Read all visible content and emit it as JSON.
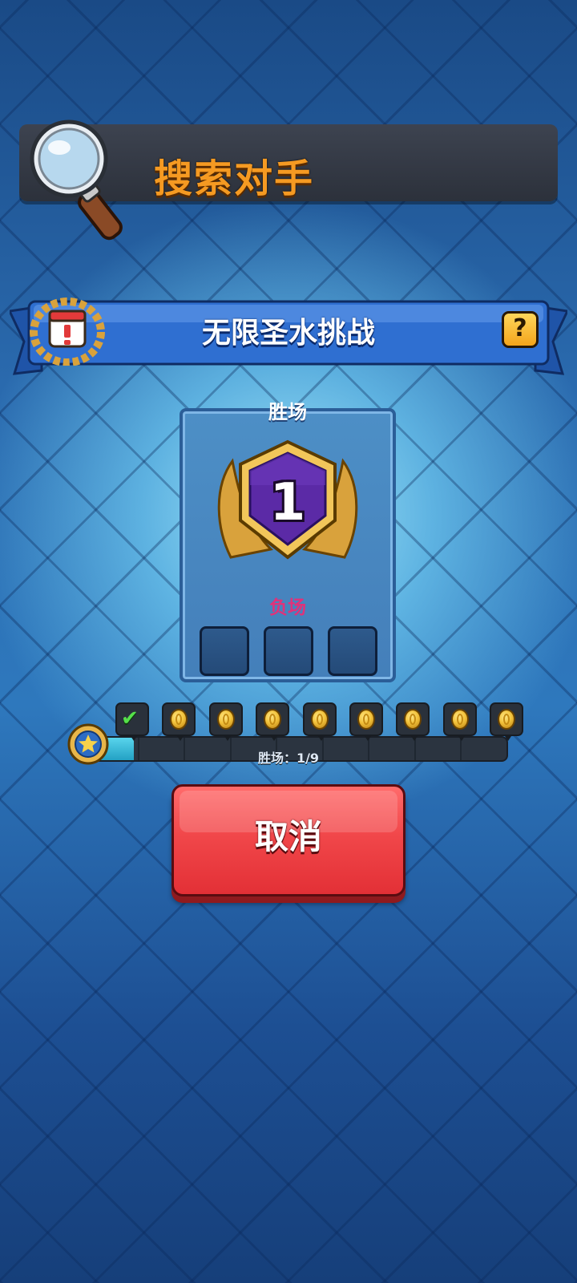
{
  "header": {
    "title": "搜索对手",
    "icon": "magnifier-icon"
  },
  "challenge": {
    "name": "无限圣水挑战",
    "icon": "calendar-laurel-icon",
    "help_label": "?"
  },
  "record": {
    "wins_label": "胜场",
    "wins_count": "1",
    "losses_label": "负场",
    "losses_used": 0,
    "losses_max": 3
  },
  "progress": {
    "text": "胜场：1/9",
    "current": 1,
    "total": 9,
    "rewards": [
      "check",
      "coin",
      "coin",
      "coin",
      "coin",
      "coin",
      "coin",
      "coin",
      "coin"
    ]
  },
  "actions": {
    "cancel_label": "取消"
  },
  "colors": {
    "title_orange": "#f59a22",
    "banner_blue": "#2f6fd1",
    "cancel_red": "#f1474a",
    "badge_purple": "#5b2aa6",
    "badge_gold": "#e8b64a",
    "losses_pink": "#e0327a"
  }
}
